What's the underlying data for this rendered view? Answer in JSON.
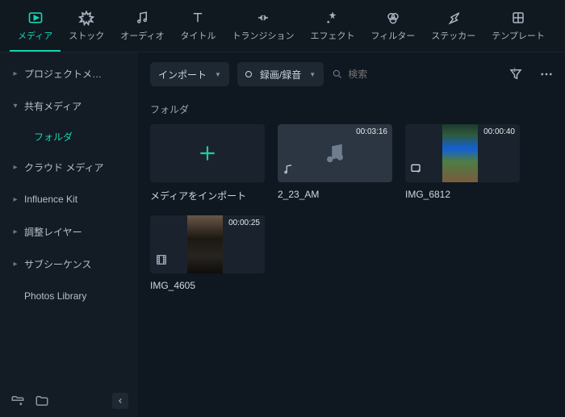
{
  "topnav": {
    "tabs": [
      {
        "label": "メディア",
        "icon": "media"
      },
      {
        "label": "ストック",
        "icon": "stock"
      },
      {
        "label": "オーディオ",
        "icon": "audio"
      },
      {
        "label": "タイトル",
        "icon": "title"
      },
      {
        "label": "トランジション",
        "icon": "transition"
      },
      {
        "label": "エフェクト",
        "icon": "effect"
      },
      {
        "label": "フィルター",
        "icon": "filter"
      },
      {
        "label": "ステッカー",
        "icon": "sticker"
      },
      {
        "label": "テンプレート",
        "icon": "template"
      }
    ]
  },
  "sidebar": {
    "items": [
      {
        "label": "プロジェクトメ…",
        "expandable": true
      },
      {
        "label": "共有メディア",
        "expandable": true,
        "expanded": true,
        "child": "フォルダ"
      },
      {
        "label": "クラウド メディア",
        "expandable": true
      },
      {
        "label": "Influence Kit",
        "expandable": true
      },
      {
        "label": "調整レイヤー",
        "expandable": true
      },
      {
        "label": "サブシーケンス",
        "expandable": true
      },
      {
        "label": "Photos Library",
        "expandable": false
      }
    ]
  },
  "toolbar": {
    "import_label": "インポート",
    "record_label": "録画/録音",
    "search_placeholder": "検索"
  },
  "content": {
    "section_label": "フォルダ",
    "import_card_label": "メディアをインポート",
    "items": [
      {
        "name": "2_23_AM",
        "duration": "00:03:16",
        "type": "audio"
      },
      {
        "name": "IMG_6812",
        "duration": "00:00:40",
        "type": "video"
      },
      {
        "name": "IMG_4605",
        "duration": "00:00:25",
        "type": "video"
      }
    ]
  }
}
